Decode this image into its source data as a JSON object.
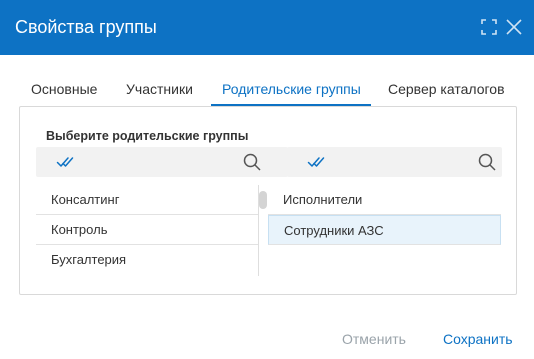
{
  "dialog": {
    "title": "Свойства группы"
  },
  "tabs": [
    {
      "label": "Основные",
      "active": false
    },
    {
      "label": "Участники",
      "active": false
    },
    {
      "label": "Родительские группы",
      "active": true
    },
    {
      "label": "Сервер каталогов",
      "active": false
    }
  ],
  "panel": {
    "label": "Выберите родительские группы",
    "available": {
      "items": [
        "Консалтинг",
        "Контроль",
        "Бухгалтерия"
      ]
    },
    "selected": {
      "items": [
        {
          "label": "Исполнители",
          "highlighted": false
        },
        {
          "label": "Сотрудники АЗС",
          "highlighted": true
        }
      ]
    }
  },
  "footer": {
    "cancel_label": "Отменить",
    "save_label": "Сохранить"
  },
  "colors": {
    "accent": "#0d72c4",
    "selection_bg": "#e8f3fb",
    "disabled_text": "#9aa3aa"
  },
  "icons": {
    "maximize": "maximize-icon",
    "close": "close-icon",
    "check_all": "check-all-icon",
    "search": "search-icon"
  }
}
